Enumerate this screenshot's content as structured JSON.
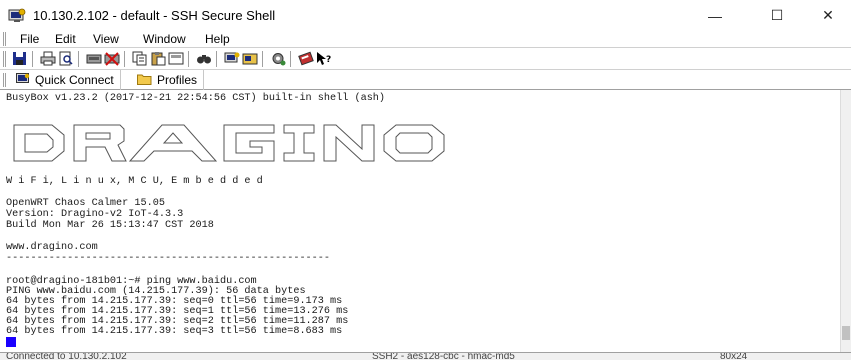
{
  "window": {
    "title": "10.130.2.102 - default - SSH Secure Shell",
    "controls": {
      "minimize": "—",
      "maximize": "☐",
      "close": "✕"
    }
  },
  "menu": {
    "items": [
      "File",
      "Edit",
      "View",
      "Window",
      "Help"
    ]
  },
  "toolbar": {
    "icons": [
      "save-icon",
      "print-icon",
      "print-preview-icon",
      "copy-icon",
      "paste-icon",
      "find-icon",
      "new-terminal-icon",
      "new-file-transfer-icon",
      "settings-icon",
      "help-icon",
      "whats-this-icon"
    ]
  },
  "quickbar": {
    "quick_connect": "Quick Connect",
    "profiles": "Profiles"
  },
  "terminal": {
    "banner": "BusyBox v1.23.2 (2017-12-21 22:54:56 CST) built-in shell (ash)",
    "tagline": "W i F i, L i n u x, M C U, E m b e d d e d",
    "os": "OpenWRT Chaos Calmer 15.05",
    "version": "Version: Dragino-v2 IoT-4.3.3",
    "build": "Build Mon Mar 26 15:13:47 CST 2018",
    "site": "www.dragino.com",
    "rule": "-----------------------------------------------------",
    "prompt": "root@dragino-181b01:~# ping www.baidu.com",
    "ping_header": "PING www.baidu.com (14.215.177.39): 56 data bytes",
    "replies": [
      "64 bytes from 14.215.177.39: seq=0 ttl=56 time=9.173 ms",
      "64 bytes from 14.215.177.39: seq=1 ttl=56 time=13.276 ms",
      "64 bytes from 14.215.177.39: seq=2 ttl=56 time=11.287 ms",
      "64 bytes from 14.215.177.39: seq=3 ttl=56 time=8.683 ms"
    ]
  },
  "status": {
    "left": "Connected to 10.130.2.102",
    "middle": "SSH2 - aes128-cbc - hmac-md5",
    "right": "80x24"
  },
  "colors": {
    "cursor": "#1a00ff",
    "terminal_text": "#1a1a1a",
    "chrome": "#ffffff"
  }
}
